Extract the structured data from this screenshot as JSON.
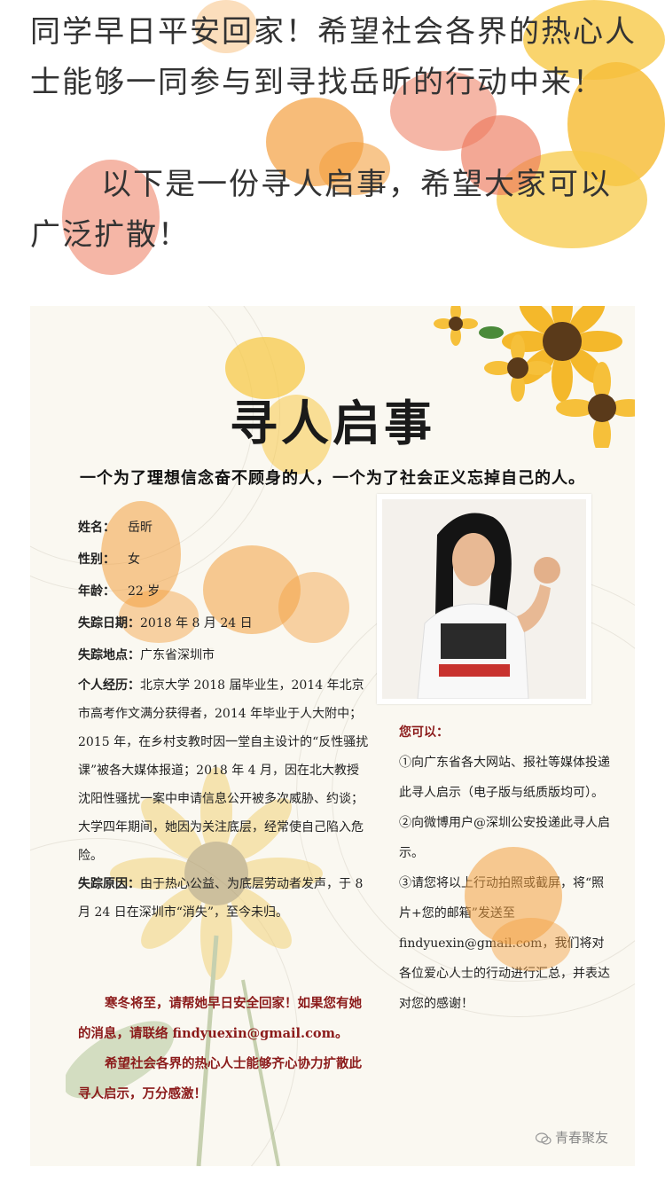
{
  "intro": {
    "paragraph1": "同学早日平安回家！希望社会各界的热心人士能够一同参与到寻找岳昕的行动中来！",
    "paragraph2": "以下是一份寻人启事，希望大家可以广泛扩散！"
  },
  "poster": {
    "title": "寻人启事",
    "tagline": "一个为了理想信念奋不顾身的人，一个为了社会正义忘掉自己的人。",
    "fields": [
      {
        "label": "姓名：",
        "value": "岳昕"
      },
      {
        "label": "性别：",
        "value": "女"
      },
      {
        "label": "年龄：",
        "value": "22 岁"
      },
      {
        "label": "失踪日期：",
        "value": "2018 年 8 月 24 日"
      },
      {
        "label": "失踪地点：",
        "value": "广东省深圳市"
      }
    ],
    "bio_label": "个人经历：",
    "bio_text": "北京大学 2018 届毕业生，2014 年北京市高考作文满分获得者，2014 年毕业于人大附中；2015 年，在乡村支教时因一堂自主设计的“反性骚扰课”被各大媒体报道；2018 年 4 月，因在北大教授沈阳性骚扰一案中申请信息公开被多次威胁、约谈；大学四年期间，她因为关注底层，经常使自己陷入危险。",
    "reason_label": "失踪原因：",
    "reason_text": "由于热心公益、为底层劳动者发声，于 8 月 24 日在深圳市“消失”，至今未归。",
    "appeal1": "寒冬将至，请帮她早日安全回家！如果您有她的消息，请联络 findyuexin@gmail.com。",
    "appeal2": "希望社会各界的热心人士能够齐心协力扩散此寻人启示，万分感激！",
    "photo_shirt_text": "团结就是力量",
    "right_heading": "您可以：",
    "right_item1": "①向广东省各大网站、报社等媒体投递此寻人启示（电子版与纸质版均可）。",
    "right_item2": "②向微博用户@深圳公安投递此寻人启示。",
    "right_item3": "③请您将以上行动拍照或截屏，将“照片+您的邮箱”发送至 findyuexin@gmail.com，我们将对各位爱心人士的行动进行汇总，并表达对您的感谢！"
  },
  "watermark": {
    "text": "青春聚友",
    "icon": "wechat-icon"
  },
  "colors": {
    "accent_red": "#8b1a1a",
    "flower_orange": "#f3a040",
    "flower_yellow": "#f7c948",
    "flower_coral": "#ec7a5c"
  }
}
